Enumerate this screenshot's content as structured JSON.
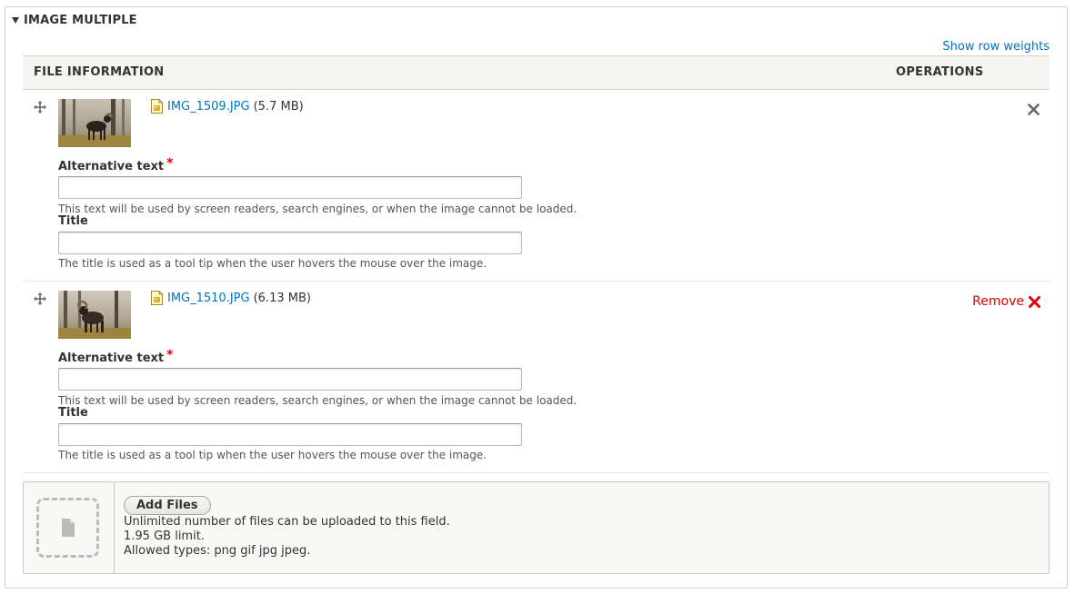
{
  "fieldset": {
    "legend": "IMAGE MULTIPLE",
    "show_row_weights": "Show row weights"
  },
  "table": {
    "headers": {
      "file_info": "FILE INFORMATION",
      "operations": "OPERATIONS"
    },
    "rows": [
      {
        "file_name": "IMG_1509.JPG",
        "file_size": "(5.7 MB)",
        "alt_label": "Alternative text",
        "alt_required": "*",
        "alt_value": "",
        "alt_desc": "This text will be used by screen readers, search engines, or when the image cannot be loaded.",
        "title_label": "Title",
        "title_value": "",
        "title_desc": "The title is used as a tool tip when the user hovers the mouse over the image.",
        "operation": {
          "label": "",
          "icon": "close-icon"
        }
      },
      {
        "file_name": "IMG_1510.JPG",
        "file_size": "(6.13 MB)",
        "alt_label": "Alternative text",
        "alt_required": "*",
        "alt_value": "",
        "alt_desc": "This text will be used by screen readers, search engines, or when the image cannot be loaded.",
        "title_label": "Title",
        "title_value": "",
        "title_desc": "The title is used as a tool tip when the user hovers the mouse over the image.",
        "operation": {
          "label": "Remove",
          "icon": "remove-x-icon",
          "color": "#e00000"
        }
      }
    ]
  },
  "upload": {
    "button_label": "Add Files",
    "info_lines": [
      "Unlimited number of files can be uploaded to this field.",
      "1.95 GB limit.",
      "Allowed types: png gif jpg jpeg."
    ]
  },
  "colors": {
    "link": "#0074bd",
    "required": "#e00000",
    "header_bg": "#f5f5f2"
  }
}
